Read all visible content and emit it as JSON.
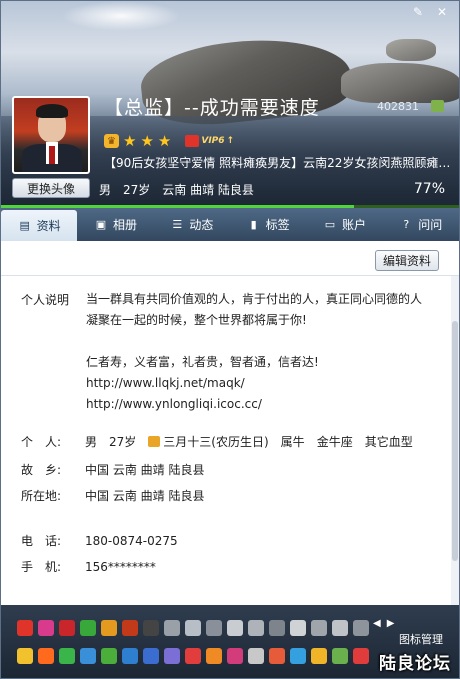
{
  "window": {
    "controls": [
      "skin-icon",
      "close-icon"
    ]
  },
  "profile": {
    "nickname": "【总监】--成功需要速度",
    "uid": "402831",
    "change_avatar_label": "更换头像",
    "mood": "【90后女孩坚守爱情 照料瘫痪男友】云南22岁女孩闵燕照顾瘫痪...",
    "gender": "男",
    "age": "27岁",
    "location": "云南 曲靖 陆良县",
    "completion": "77%",
    "completion_value": 0.77,
    "vip_label": "VIP6",
    "stars": 3
  },
  "tabs": [
    {
      "label": "资料",
      "icon": "profile-card-icon",
      "active": true
    },
    {
      "label": "相册",
      "icon": "album-icon"
    },
    {
      "label": "动态",
      "icon": "feed-icon"
    },
    {
      "label": "标签",
      "icon": "tag-icon"
    },
    {
      "label": "账户",
      "icon": "wallet-icon"
    },
    {
      "label": "问问",
      "icon": "question-icon"
    }
  ],
  "content": {
    "edit_button": "编辑资料",
    "personal_desc_label": "个人说明",
    "personal_desc": [
      "当一群具有共同价值观的人，肯于付出的人，真正同心同德的人",
      "凝聚在一起的时候，整个世界都将属于你!",
      "",
      "仁者寿，义者富，礼者贵，智者通，信者达!",
      "http://www.llqkj.net/maqk/",
      "http://www.ynlongliqi.icoc.cc/"
    ],
    "personal": {
      "label": "个　人:",
      "gender": "男",
      "age": "27岁",
      "birthday": "三月十三(农历生日)",
      "zodiac": "属牛",
      "constellation": "金牛座",
      "blood": "其它血型"
    },
    "hometown": {
      "label": "故　乡:",
      "value": "中国 云南 曲靖 陆良县"
    },
    "residence": {
      "label": "所在地:",
      "value": "中国 云南 曲靖 陆良县"
    },
    "phone": {
      "label": "电　话:",
      "value": "180-0874-0275"
    },
    "mobile": {
      "label": "手　机:",
      "value": "156********"
    }
  },
  "icon_panel": {
    "manage_label": "图标管理",
    "watermark": "陆良论坛",
    "row1_colors": [
      "#e0332a",
      "#d83b8c",
      "#c8262a",
      "#38a83a",
      "#e49a1e",
      "#c23a1a",
      "#444",
      "#9aa0a8",
      "#b8bec6",
      "#8a9099",
      "#c9ccd0",
      "#aeb3b9",
      "#7e848c",
      "#d0d3d6",
      "#a0a5ab",
      "#bfc3c8",
      "#8e949b"
    ],
    "row2_colors": [
      "#f2c12e",
      "#ff6a1e",
      "#3ab54a",
      "#3a8fd9",
      "#4cae3a",
      "#2f7fd1",
      "#3b6ccf",
      "#7b6fd6",
      "#e23d3d",
      "#f08a24",
      "#d23c7a",
      "#c8c8c8",
      "#e65c3a",
      "#35a0e0",
      "#f0b428",
      "#6ab04c",
      "#e03c3c"
    ]
  }
}
